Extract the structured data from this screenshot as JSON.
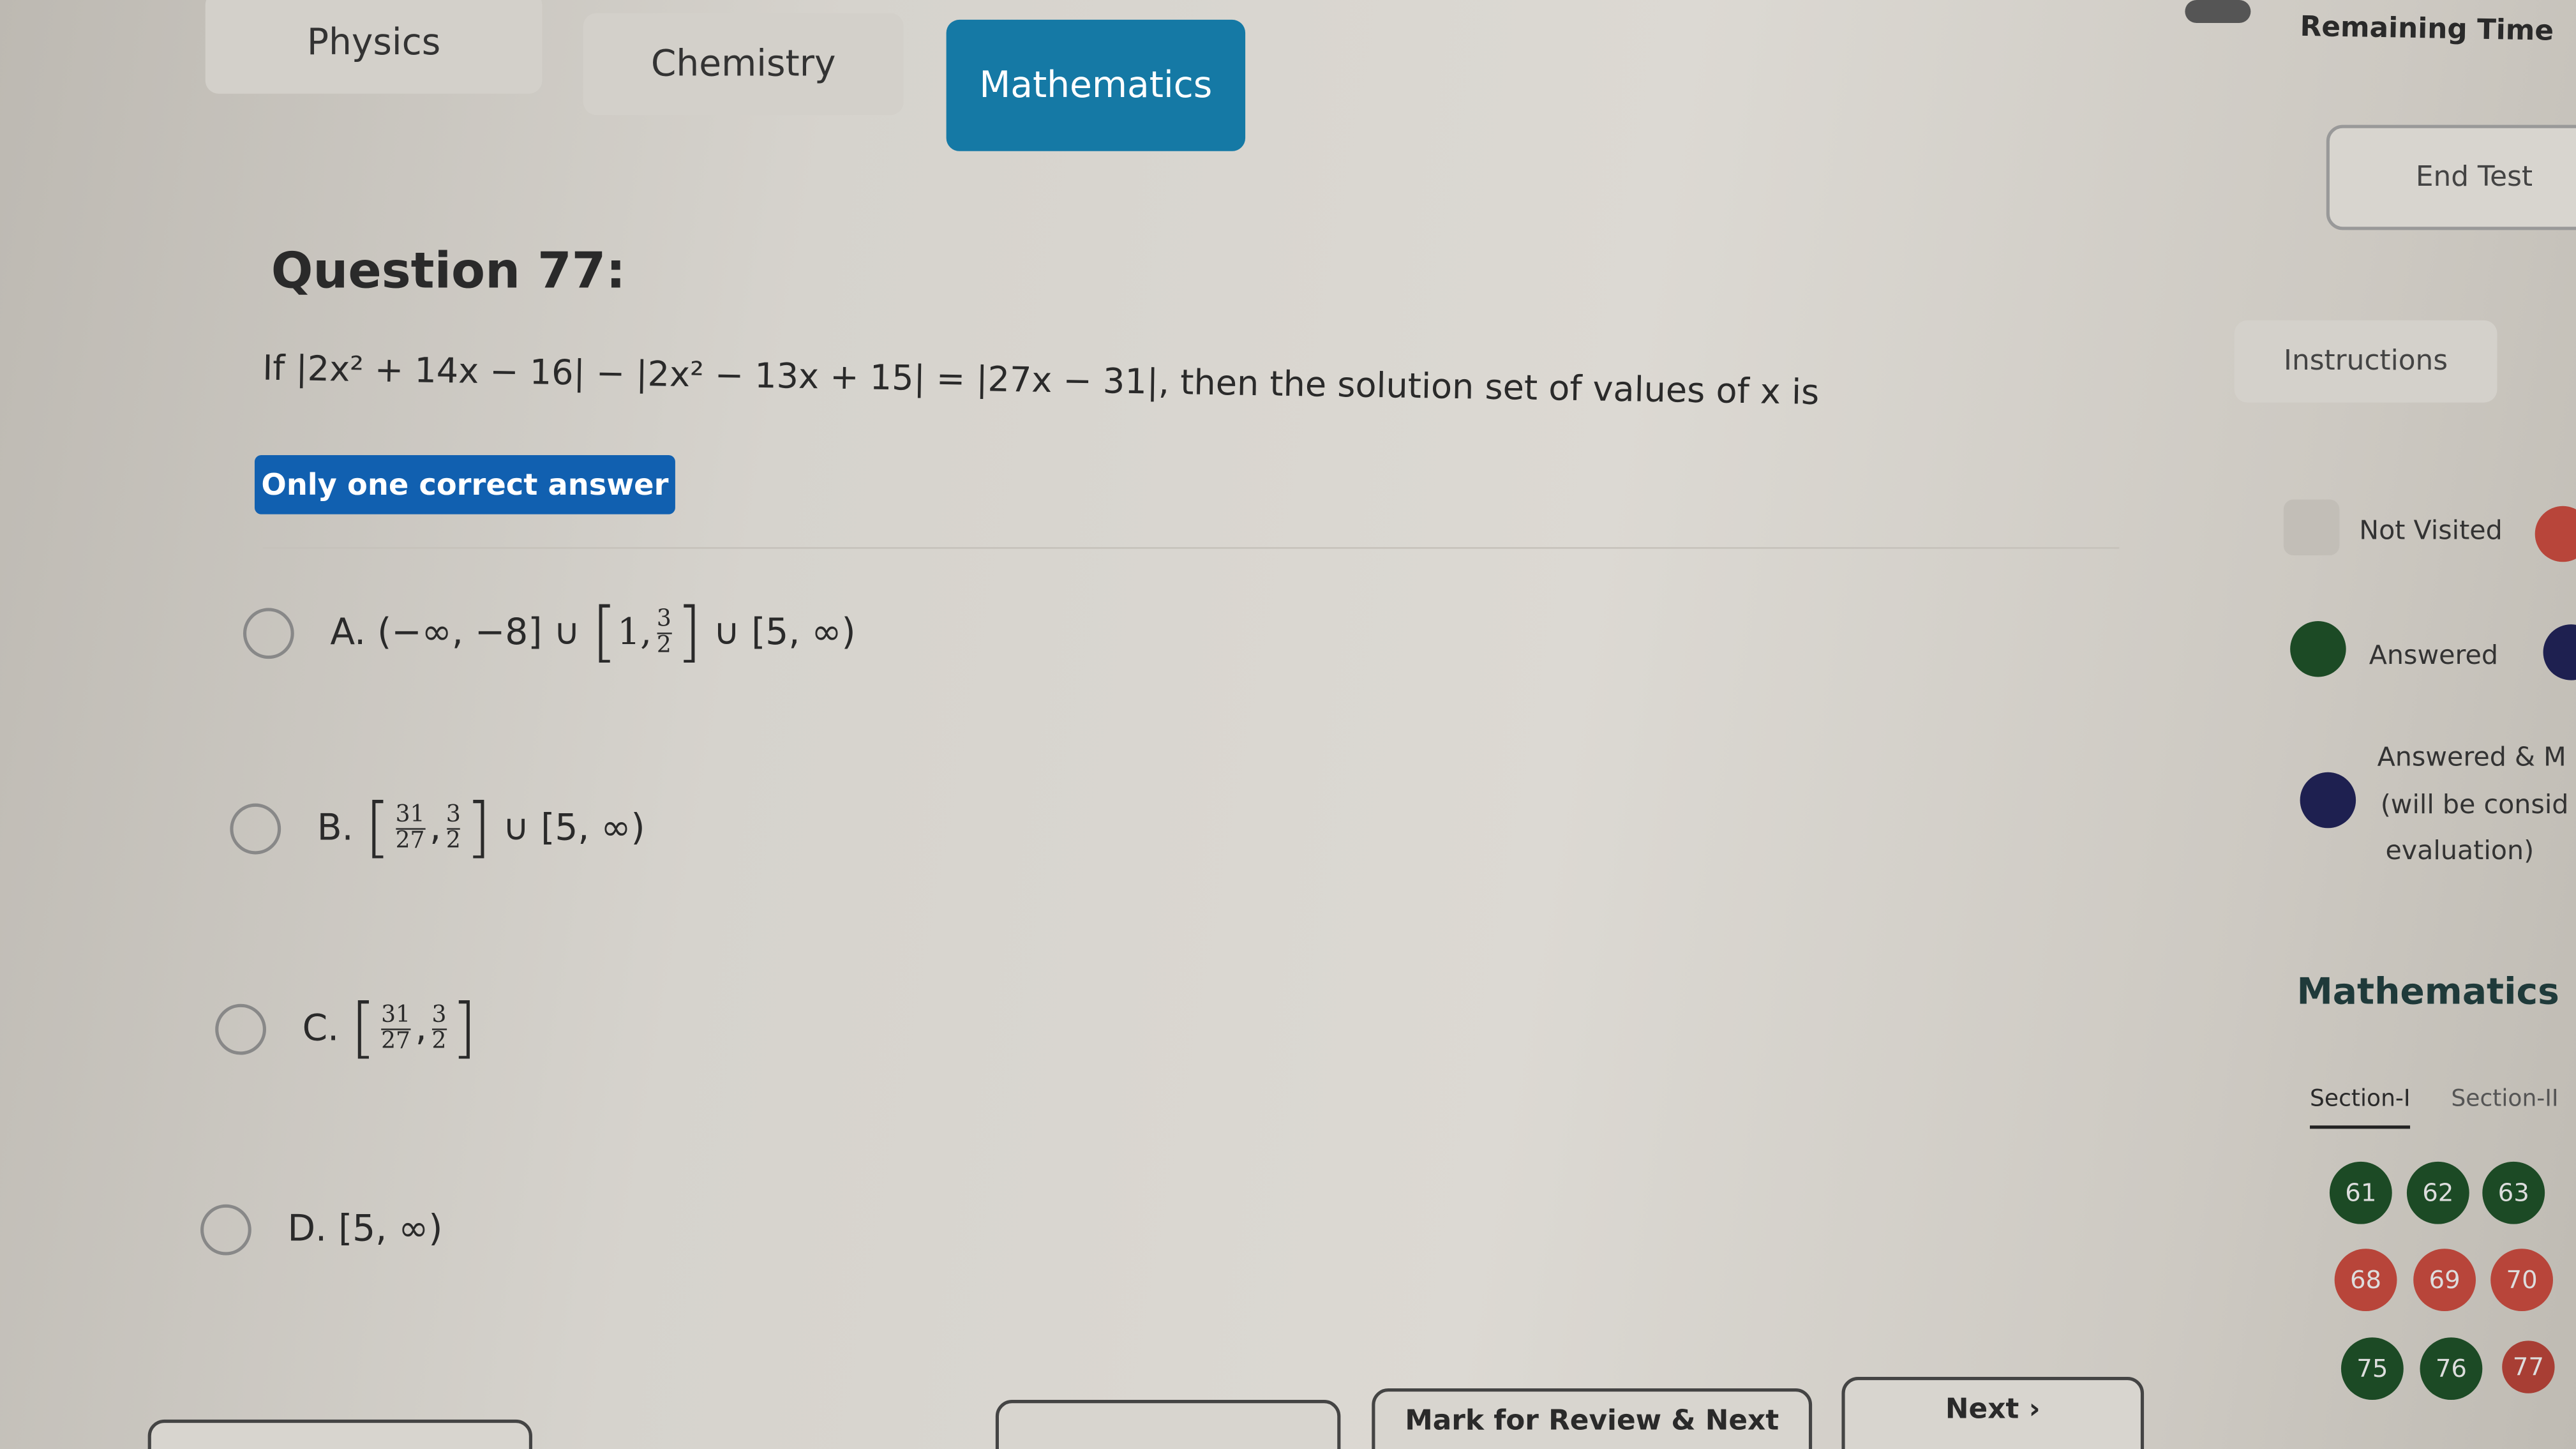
{
  "tabs": [
    {
      "label": "Physics"
    },
    {
      "label": "Chemistry"
    },
    {
      "label": "Mathematics",
      "active": true
    }
  ],
  "header": {
    "remaining_time_label": "Remaining Time",
    "end_test": "End Test",
    "instructions": "Instructions"
  },
  "question": {
    "title": "Question 77:",
    "text_prefix": "If |2x² + 14x − 16| − |2x² − 13x + 15| = |27x − 31|, then the solution set of values of x is",
    "badge": "Only one correct answer",
    "options": [
      {
        "label": "A.",
        "pre": "(−∞, −8] ∪",
        "f1": "1,",
        "num": "3",
        "den": "2",
        "post": "∪ [5, ∞)"
      },
      {
        "label": "B.",
        "n1": "31",
        "d1": "27",
        "n2": "3",
        "d2": "2",
        "post": "∪ [5, ∞)"
      },
      {
        "label": "C.",
        "n1": "31",
        "d1": "27",
        "n2": "3",
        "d2": "2"
      },
      {
        "label": "D.",
        "text": "[5, ∞)"
      }
    ]
  },
  "legend": [
    {
      "label": "Not Visited",
      "color": "#bdb9b2"
    },
    {
      "label": "Answered",
      "color": "#1c4a25"
    },
    {
      "label": "Answered & Marked for Review",
      "label_visible": "Answered & M",
      "sub1": "(will be consid",
      "sub2": "evaluation)",
      "color": "#1e2050"
    }
  ],
  "palette": {
    "subject": "Mathematics",
    "sections": [
      "Section-I",
      "Section-II"
    ],
    "questions": [
      {
        "n": "61",
        "status": "answered"
      },
      {
        "n": "62",
        "status": "answered"
      },
      {
        "n": "63",
        "status": "answered"
      },
      {
        "n": "68",
        "status": "not-answered"
      },
      {
        "n": "69",
        "status": "not-answered"
      },
      {
        "n": "70",
        "status": "not-answered"
      },
      {
        "n": "75",
        "status": "answered"
      },
      {
        "n": "76",
        "status": "answered"
      },
      {
        "n": "77",
        "status": "not-answered"
      }
    ]
  },
  "colors": {
    "accent": "#1579a5",
    "answered": "#1c4a25",
    "not_answered": "#b8453a"
  },
  "footer": {
    "mark_review_next": "Mark for Review & Next",
    "next": "Next ›"
  }
}
